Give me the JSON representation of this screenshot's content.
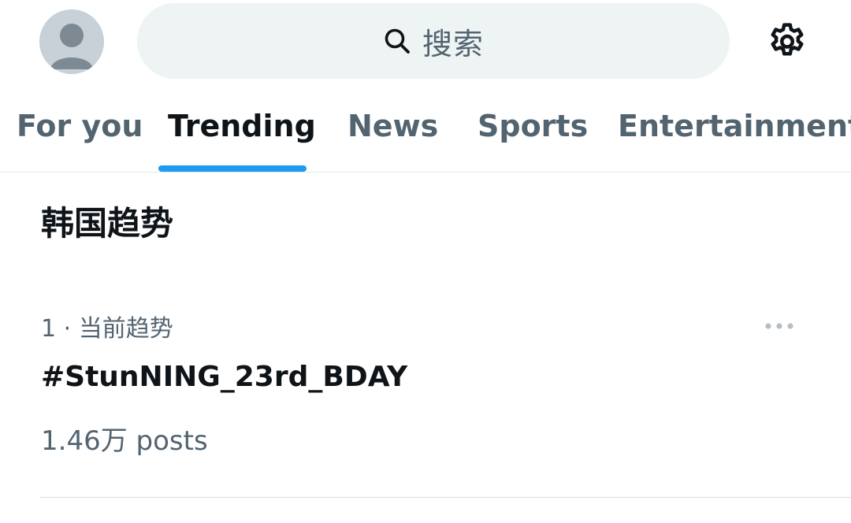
{
  "header": {
    "search_placeholder": "搜索"
  },
  "tabs": [
    {
      "label": "For you",
      "active": false
    },
    {
      "label": "Trending",
      "active": true
    },
    {
      "label": "News",
      "active": false
    },
    {
      "label": "Sports",
      "active": false
    },
    {
      "label": "Entertainment",
      "active": false
    }
  ],
  "section": {
    "title": "韩国趋势"
  },
  "trends": [
    {
      "rank": "1",
      "separator": " · ",
      "category": "当前趋势",
      "name": "#StunNING_23rd_BDAY",
      "posts": "1.46万 posts"
    }
  ],
  "colors": {
    "accent": "#1d9bf0",
    "text_primary": "#0f1419",
    "text_secondary": "#536471",
    "search_bg": "#eef3f4"
  },
  "icons": {
    "avatar": "default-avatar-icon",
    "search": "search-icon",
    "settings": "gear-icon",
    "more": "more-horizontal-icon"
  }
}
